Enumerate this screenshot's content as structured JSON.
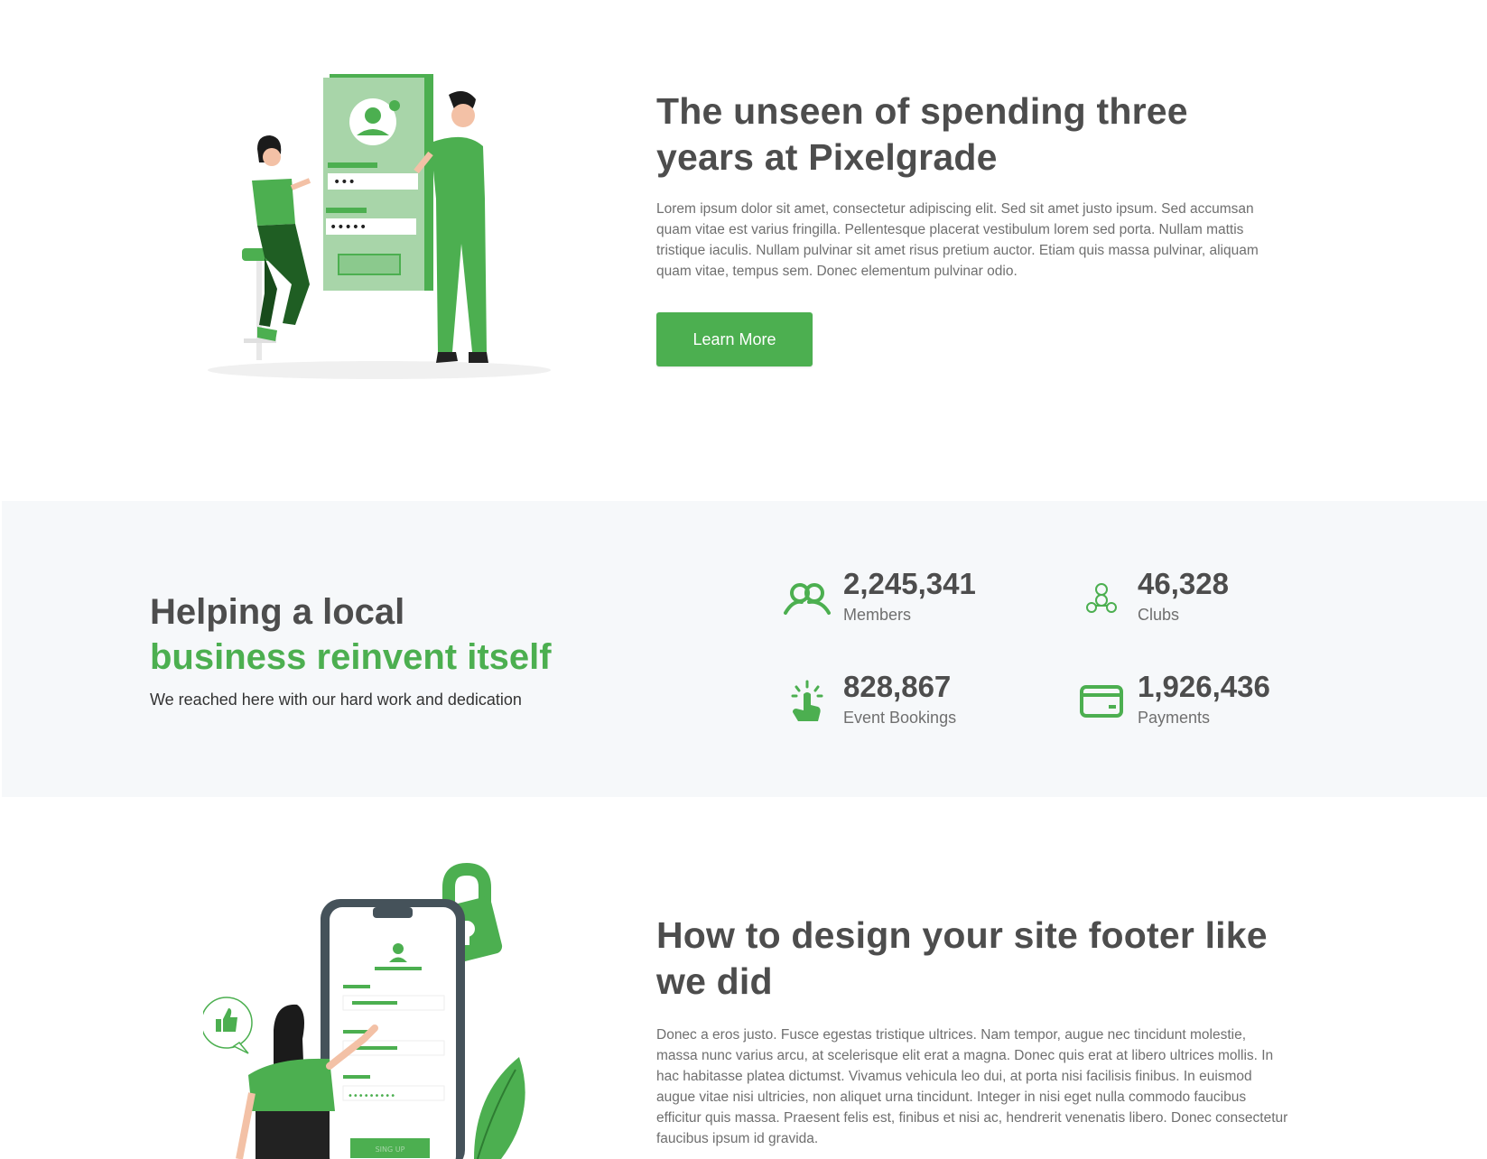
{
  "hero": {
    "title": "The unseen of spending three years at Pixelgrade",
    "body": "Lorem ipsum dolor sit amet, consectetur adipiscing elit. Sed sit amet justo ipsum. Sed accumsan quam vitae est varius fringilla. Pellentesque placerat vestibulum lorem sed porta. Nullam mattis tristique iaculis. Nullam pulvinar sit amet risus pretium auctor. Etiam quis massa pulvinar, aliquam quam vitae, tempus sem. Donec elementum pulvinar odio.",
    "button_label": "Learn More",
    "illustration": {
      "password_dots_1": "•••",
      "password_dots_2": "•••••"
    }
  },
  "stats": {
    "title_line1": "Helping a local",
    "title_line2": "business reinvent itself",
    "subtitle": "We reached here with our hard work and dedication",
    "items": [
      {
        "icon": "members-icon",
        "value": "2,245,341",
        "label": "Members"
      },
      {
        "icon": "clubs-icon",
        "value": "46,328",
        "label": "Clubs"
      },
      {
        "icon": "tap-icon",
        "value": "828,867",
        "label": "Event Bookings"
      },
      {
        "icon": "wallet-icon",
        "value": "1,926,436",
        "label": "Payments"
      }
    ]
  },
  "footer_article": {
    "title": "How to design your site footer like we did",
    "body": "Donec a eros justo. Fusce egestas tristique ultrices. Nam tempor, augue nec tincidunt molestie, massa nunc varius arcu, at scelerisque elit erat a magna. Donec quis erat at libero ultrices mollis. In hac habitasse platea dictumst. Vivamus vehicula leo dui, at porta nisi facilisis finibus. In euismod augue vitae nisi ultricies, non aliquet urna tincidunt. Integer in nisi eget nulla commodo faucibus efficitur quis massa. Praesent felis est, finibus et nisi ac, hendrerit venenatis libero. Donec consectetur faucibus ipsum id gravida.",
    "illustration": {
      "password_dots": "•••••••••",
      "signup_label": "SING UP"
    }
  },
  "colors": {
    "accent": "#4caf50",
    "heading": "#4d4d4d",
    "body": "#6f6f6f",
    "stats_bg": "#f6f8fa"
  }
}
